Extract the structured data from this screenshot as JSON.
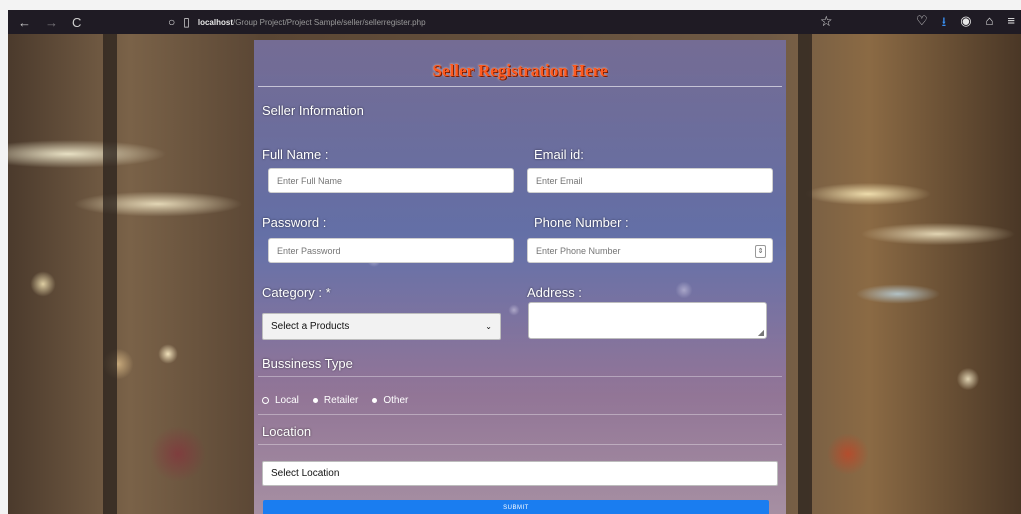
{
  "browser": {
    "back": "←",
    "forward": "→",
    "reload": "C",
    "url_host": "localhost",
    "url_path": "/Group Project/Project Sample/seller/sellerregister.php"
  },
  "form": {
    "title": "Seller Registration Here",
    "section": "Seller Information",
    "full_name_label": "Full Name :",
    "full_name_placeholder": "Enter Full Name",
    "email_label": "Email id:",
    "email_placeholder": "Enter Email",
    "password_label": "Password :",
    "password_placeholder": "Enter Password",
    "phone_label": "Phone Number :",
    "phone_placeholder": "Enter Phone Number",
    "category_label": "Category : *",
    "category_selected": "Select a Products",
    "address_label": "Address :",
    "business_type_label": "Bussiness Type",
    "business_options": [
      "Local",
      "Retailer",
      "Other"
    ],
    "location_label": "Location",
    "location_selected": "Select Location",
    "submit_label": "SUBMIT"
  }
}
